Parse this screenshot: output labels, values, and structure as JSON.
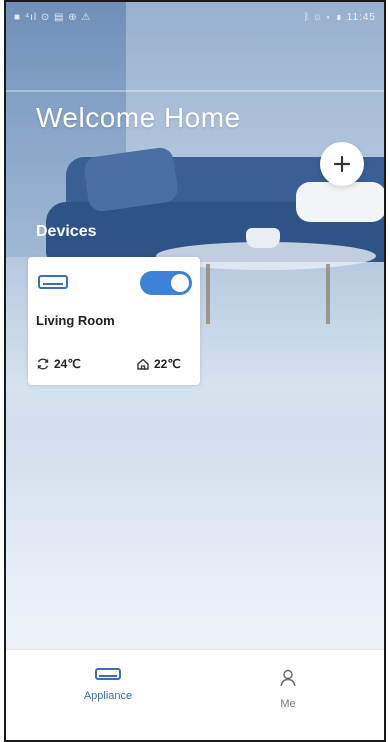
{
  "statusbar": {
    "left": "■ ⁴ıl ⊙ ▤ ⊕ ⚠",
    "right": "ᛒ ⊙ ▾ ▮ 11:45"
  },
  "header": {
    "title": "Welcome Home"
  },
  "section": {
    "devices_label": "Devices"
  },
  "device": {
    "name": "Living Room",
    "power_on": true,
    "set_temp": "24℃",
    "room_temp": "22℃"
  },
  "tabs": [
    {
      "label": "Appliance",
      "active": true,
      "icon": "air-conditioner-icon"
    },
    {
      "label": "Me",
      "active": false,
      "icon": "person-icon"
    }
  ],
  "colors": {
    "accent": "#3d82d6",
    "active_tab": "#3a6fb5",
    "inactive_tab": "#7a7a7a"
  }
}
